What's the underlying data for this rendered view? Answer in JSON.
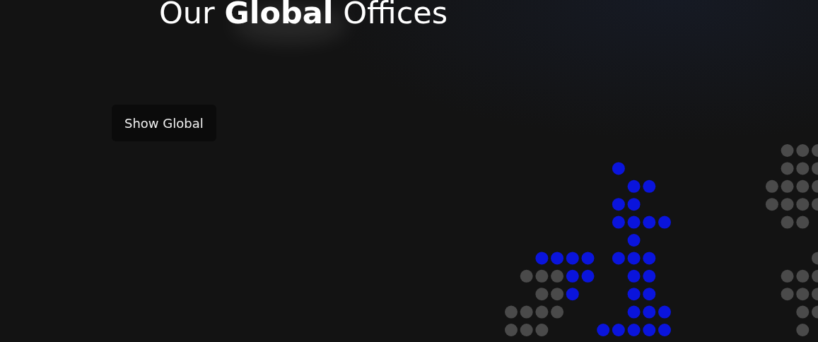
{
  "heading": "Our **Global** Offices",
  "button": {
    "label": "Show Global"
  }
}
